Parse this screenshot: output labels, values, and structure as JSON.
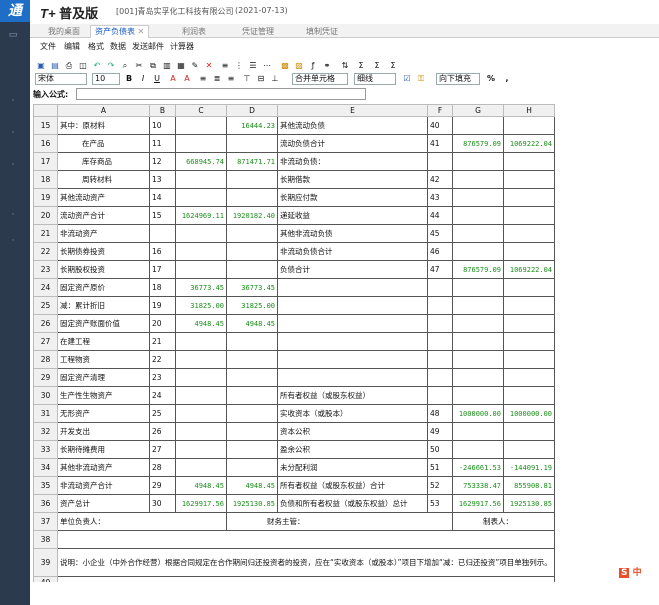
{
  "app": {
    "logo_glyph": "通",
    "brand_mark": "T+",
    "brand": "普及版",
    "company": "[001]青岛实孚化工科技有限公司",
    "date": "(2021-07-13)"
  },
  "tabs": [
    {
      "label": "我的桌面",
      "active": false
    },
    {
      "label": "资产负债表",
      "active": true
    },
    {
      "label": "利润表",
      "active": false
    },
    {
      "label": "凭证管理",
      "active": false
    },
    {
      "label": "填制凭证",
      "active": false
    }
  ],
  "menu": [
    "文件",
    "编辑",
    "格式",
    "数据",
    "发送邮件",
    "计算器"
  ],
  "toolbar": {
    "font": "宋体",
    "size": "10",
    "merge": "合并单元格",
    "border": "细线",
    "fill": "向下填充",
    "percent": "%",
    "comma": ","
  },
  "formula": {
    "label": "输入公式:",
    "value": ""
  },
  "columns": [
    "A",
    "B",
    "C",
    "D",
    "E",
    "F",
    "G",
    "H"
  ],
  "rows": [
    {
      "n": "15",
      "a": "其中：原材料",
      "b": "10",
      "c": "",
      "d": "16444.23",
      "e": "其他流动负债",
      "f": "40",
      "g": "",
      "h": ""
    },
    {
      "n": "16",
      "a": "在产品",
      "b": "11",
      "c": "",
      "d": "",
      "e": "流动负债合计",
      "f": "41",
      "g": "876579.09",
      "h": "1069222.04"
    },
    {
      "n": "17",
      "a": "库存商品",
      "b": "12",
      "c": "668945.74",
      "d": "871471.71",
      "e": "非流动负债：",
      "f": "",
      "g": "",
      "h": ""
    },
    {
      "n": "18",
      "a": "周转材料",
      "b": "13",
      "c": "",
      "d": "",
      "e": "长期借款",
      "f": "42",
      "g": "",
      "h": ""
    },
    {
      "n": "19",
      "a": "其他流动资产",
      "b": "14",
      "c": "",
      "d": "",
      "e": "长期应付款",
      "f": "43",
      "g": "",
      "h": ""
    },
    {
      "n": "20",
      "a": "流动资产合计",
      "b": "15",
      "c": "1624969.11",
      "d": "1920182.40",
      "e": "递延收益",
      "f": "44",
      "g": "",
      "h": ""
    },
    {
      "n": "21",
      "a": "非流动资产",
      "b": "",
      "c": "",
      "d": "",
      "e": "其他非流动负债",
      "f": "45",
      "g": "",
      "h": ""
    },
    {
      "n": "22",
      "a": "长期债券投资",
      "b": "16",
      "c": "",
      "d": "",
      "e": "非流动负债合计",
      "f": "46",
      "g": "",
      "h": ""
    },
    {
      "n": "23",
      "a": "长期股权投资",
      "b": "17",
      "c": "",
      "d": "",
      "e": "负债合计",
      "f": "47",
      "g": "876579.09",
      "h": "1069222.04"
    },
    {
      "n": "24",
      "a": "固定资产原价",
      "b": "18",
      "c": "36773.45",
      "d": "36773.45",
      "e": "",
      "f": "",
      "g": "",
      "h": ""
    },
    {
      "n": "25",
      "a": "减：累计折旧",
      "b": "19",
      "c": "31825.00",
      "d": "31825.00",
      "e": "",
      "f": "",
      "g": "",
      "h": ""
    },
    {
      "n": "26",
      "a": "固定资产账面价值",
      "b": "20",
      "c": "4948.45",
      "d": "4948.45",
      "e": "",
      "f": "",
      "g": "",
      "h": ""
    },
    {
      "n": "27",
      "a": "在建工程",
      "b": "21",
      "c": "",
      "d": "",
      "e": "",
      "f": "",
      "g": "",
      "h": ""
    },
    {
      "n": "28",
      "a": "工程物资",
      "b": "22",
      "c": "",
      "d": "",
      "e": "",
      "f": "",
      "g": "",
      "h": ""
    },
    {
      "n": "29",
      "a": "固定资产清理",
      "b": "23",
      "c": "",
      "d": "",
      "e": "",
      "f": "",
      "g": "",
      "h": ""
    },
    {
      "n": "30",
      "a": "生产性生物资产",
      "b": "24",
      "c": "",
      "d": "",
      "e": "所有者权益（或股东权益）",
      "f": "",
      "g": "",
      "h": ""
    },
    {
      "n": "31",
      "a": "无形资产",
      "b": "25",
      "c": "",
      "d": "",
      "e": "实收资本（或股本）",
      "f": "48",
      "g": "1000000.00",
      "h": "1000000.00"
    },
    {
      "n": "32",
      "a": "开发支出",
      "b": "26",
      "c": "",
      "d": "",
      "e": "资本公积",
      "f": "49",
      "g": "",
      "h": ""
    },
    {
      "n": "33",
      "a": "长期待摊费用",
      "b": "27",
      "c": "",
      "d": "",
      "e": "盈余公积",
      "f": "50",
      "g": "",
      "h": ""
    },
    {
      "n": "34",
      "a": "其他非流动资产",
      "b": "28",
      "c": "",
      "d": "",
      "e": "未分配利润",
      "f": "51",
      "g": "-246661.53",
      "h": "-144091.19"
    },
    {
      "n": "35",
      "a": "非流动资产合计",
      "b": "29",
      "c": "4948.45",
      "d": "4948.45",
      "e": "所有者权益（或股东权益）合计",
      "f": "52",
      "g": "753338.47",
      "h": "855908.81"
    },
    {
      "n": "36",
      "a": "资产总计",
      "b": "30",
      "c": "1629917.56",
      "d": "1925130.85",
      "e": "负债和所有者权益（或股东权益）总计",
      "f": "53",
      "g": "1629917.56",
      "h": "1925130.85"
    }
  ],
  "row37": {
    "n": "37",
    "a": "单位负责人：",
    "d": "财务主管：",
    "g": "制表人："
  },
  "row38": {
    "n": "38"
  },
  "row39": {
    "n": "39",
    "note": "说明：小企业（中外合作经营）根据合同规定在合作期间归还投资者的投资，应在“实收资本（或股本）”项目下增加“减：已归还投资”项目单独列示。"
  },
  "row40": {
    "n": "40"
  },
  "ime": {
    "label": "中"
  }
}
